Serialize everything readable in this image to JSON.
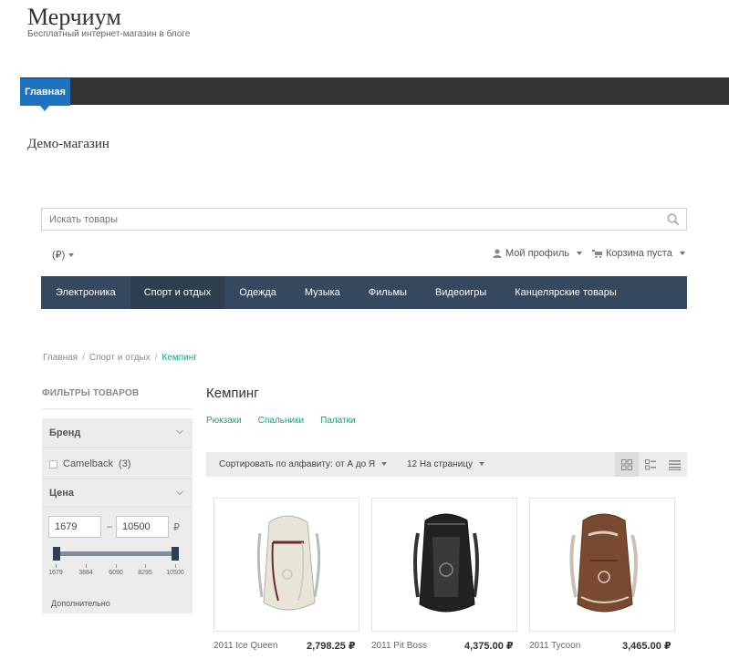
{
  "site": {
    "title": "Мерчиум",
    "description": "Бесплатный интернет-магазин в блоге"
  },
  "topnav": {
    "items": [
      {
        "label": "Главная"
      }
    ],
    "active_color": "#1e73be"
  },
  "page": {
    "title": "Демо-магазин"
  },
  "search": {
    "placeholder": "Искать товары",
    "value": ""
  },
  "header_bar": {
    "currency": "(₽)",
    "profile": "Мой профиль",
    "cart": "Корзина пуста"
  },
  "categories": [
    {
      "label": "Электроника"
    },
    {
      "label": "Спорт и отдых"
    },
    {
      "label": "Одежда"
    },
    {
      "label": "Музыка"
    },
    {
      "label": "Фильмы"
    },
    {
      "label": "Видеоигры"
    },
    {
      "label": "Канцелярские товары"
    }
  ],
  "breadcrumb": {
    "home": "Главная",
    "parent": "Спорт и отдых",
    "current": "Кемпинг"
  },
  "filters": {
    "title": "ФИЛЬТРЫ ТОВАРОВ",
    "brand": {
      "label": "Бренд",
      "options": [
        {
          "label": "Camelback",
          "count": "(3)"
        }
      ]
    },
    "price": {
      "label": "Цена",
      "min": "1679",
      "dash": "–",
      "max": "10500",
      "currency": "₽",
      "ticks": [
        "1679",
        "3884",
        "6090",
        "8295",
        "10500"
      ]
    },
    "more": "Дополнительно"
  },
  "category": {
    "title": "Кемпинг",
    "subcategories": [
      "Рюкзаки",
      "Спальники",
      "Палатки"
    ]
  },
  "toolbar": {
    "sort": "Сортировать по алфавиту: от А до Я",
    "per_page": "12 На страницу"
  },
  "products": [
    {
      "name": "2011 Ice Queen",
      "price": "2,798.25 ₽",
      "color": "#e9e4d8"
    },
    {
      "name": "2011 Pit Boss",
      "price": "4,375.00 ₽",
      "color": "#222222"
    },
    {
      "name": "2011 Tycoon",
      "price": "3,465.00 ₽",
      "color": "#7a4a30"
    }
  ],
  "colors": {
    "catnav": "#34495e",
    "catnav_active": "#2c3e50",
    "link": "#16a085",
    "filter_bg": "#ececec"
  }
}
